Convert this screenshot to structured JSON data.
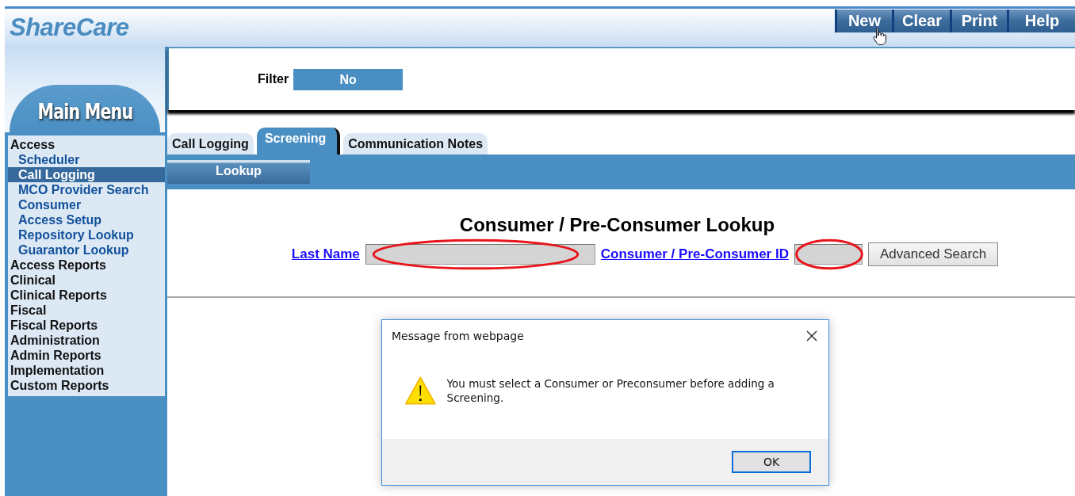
{
  "app": {
    "logo": "ShareCare"
  },
  "toolbar": [
    {
      "label": "New",
      "hovered": true
    },
    {
      "label": "Clear",
      "hovered": false
    },
    {
      "label": "Print",
      "hovered": false
    },
    {
      "label": "Help",
      "hovered": false
    }
  ],
  "filter": {
    "label": "Filter",
    "value": "No"
  },
  "sidebar": {
    "title": "Main Menu",
    "items": [
      {
        "label": "Access",
        "selected": false,
        "children": [
          {
            "label": "Scheduler",
            "selected": false
          },
          {
            "label": "Call Logging",
            "selected": true
          },
          {
            "label": "MCO Provider Search",
            "selected": false
          },
          {
            "label": "Consumer",
            "selected": false
          },
          {
            "label": "Access Setup",
            "selected": false
          },
          {
            "label": "Repository Lookup",
            "selected": false
          },
          {
            "label": "Guarantor Lookup",
            "selected": false
          }
        ]
      },
      {
        "label": "Access Reports",
        "selected": false
      },
      {
        "label": "Clinical",
        "selected": false
      },
      {
        "label": "Clinical Reports",
        "selected": false
      },
      {
        "label": "Fiscal",
        "selected": false
      },
      {
        "label": "Fiscal Reports",
        "selected": false
      },
      {
        "label": "Administration",
        "selected": false
      },
      {
        "label": "Admin Reports",
        "selected": false
      },
      {
        "label": "Implementation",
        "selected": false
      },
      {
        "label": "Custom Reports",
        "selected": false
      }
    ]
  },
  "tabs": [
    {
      "label": "Call Logging",
      "selected": false
    },
    {
      "label": "Screening",
      "selected": true
    },
    {
      "label": "Communication Notes",
      "selected": false
    }
  ],
  "subtabs": [
    {
      "label": "Lookup",
      "selected": true
    }
  ],
  "lookup": {
    "title": "Consumer / Pre-Consumer Lookup",
    "fields": [
      {
        "label": "Last Name",
        "kind": "wide",
        "circled": true
      },
      {
        "label": "Consumer / Pre-Consumer ID",
        "kind": "narrow",
        "circled": true
      }
    ],
    "button": "Advanced Search"
  },
  "dialog": {
    "title": "Message from webpage",
    "message": "You must select a Consumer or Preconsumer before adding a Screening.",
    "button": "OK"
  }
}
